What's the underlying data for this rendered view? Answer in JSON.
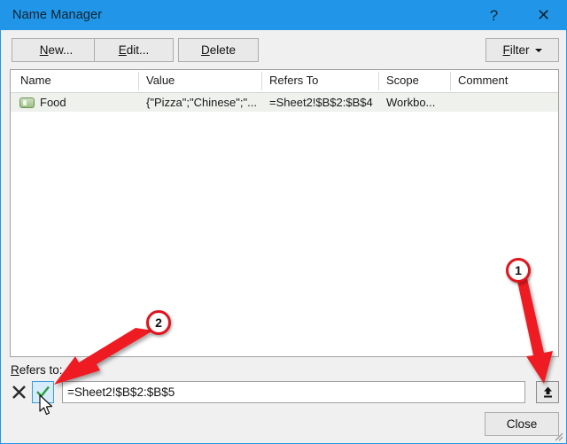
{
  "window": {
    "title": "Name Manager",
    "help_icon": "?",
    "close_icon": "✕"
  },
  "toolbar": {
    "new_label": "New...",
    "new_accesskey": "N",
    "edit_label": "Edit...",
    "edit_accesskey": "E",
    "delete_label": "Delete",
    "delete_accesskey": "D",
    "filter_label": "Filter",
    "filter_accesskey": "F"
  },
  "list": {
    "columns": [
      "Name",
      "Value",
      "Refers To",
      "Scope",
      "Comment"
    ],
    "rows": [
      {
        "name": "Food",
        "value": "{\"Pizza\";\"Chinese\";\"...",
        "refers_to": "=Sheet2!$B$2:$B$4",
        "scope": "Workbo...",
        "comment": ""
      }
    ]
  },
  "refers_to": {
    "label": "Refers to:",
    "label_accesskey": "R",
    "value": "=Sheet2!$B$2:$B$5",
    "cancel_icon": "✕",
    "confirm_icon": "✓",
    "collapse_icon": "collapse-dialog-icon"
  },
  "footer": {
    "close_label": "Close"
  },
  "annotations": [
    {
      "id": "1",
      "label": "1"
    },
    {
      "id": "2",
      "label": "2"
    }
  ],
  "colors": {
    "titlebar": "#2196e8",
    "annotation_red": "#e0141c",
    "confirm_green": "#2e9c3f",
    "dialog_bg": "#f0f0f0"
  }
}
